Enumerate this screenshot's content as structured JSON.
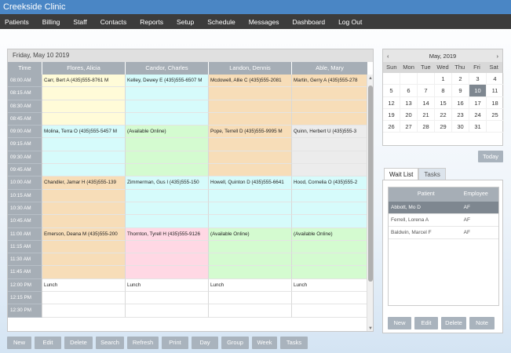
{
  "app": {
    "title": "Creekside Clinic"
  },
  "menu": [
    "Patients",
    "Billing",
    "Staff",
    "Contacts",
    "Reports",
    "Setup",
    "Schedule",
    "Messages",
    "Dashboard",
    "Log Out"
  ],
  "schedule": {
    "date": "Friday, May  10  2019",
    "time_header": "Time",
    "columns": [
      "Flores, Alicia",
      "Candor, Charles",
      "Landon, Dennis",
      "Able, Mary"
    ],
    "rows": [
      {
        "time": "08:00 AM",
        "cells": [
          [
            "Carr, Bert A (435)555-8761 M",
            "#fffbd8"
          ],
          [
            "Kelley, Dewey E (435)555-6507 M",
            "#d6fbfb"
          ],
          [
            "Mcdowell, Allie C (435)555-2081",
            "#f7ddb8"
          ],
          [
            "Martin, Gerry A (435)555-278",
            "#f7ddb8"
          ]
        ]
      },
      {
        "time": "08:15 AM",
        "cells": [
          [
            "",
            "#fffbd8"
          ],
          [
            "",
            "#d6fbfb"
          ],
          [
            "",
            "#f7ddb8"
          ],
          [
            "",
            "#f7ddb8"
          ]
        ]
      },
      {
        "time": "08:30 AM",
        "cells": [
          [
            "",
            "#fffbd8"
          ],
          [
            "",
            "#d6fbfb"
          ],
          [
            "",
            "#f7ddb8"
          ],
          [
            "",
            "#f7ddb8"
          ]
        ]
      },
      {
        "time": "08:45 AM",
        "cells": [
          [
            "",
            "#fffbd8"
          ],
          [
            "",
            "#d6fbfb"
          ],
          [
            "",
            "#f7ddb8"
          ],
          [
            "",
            "#f7ddb8"
          ]
        ]
      },
      {
        "time": "09:00 AM",
        "cells": [
          [
            "Molina, Terra O (435)555-5457 M",
            "#d6fbfb"
          ],
          [
            "(Available Online)",
            "#d4fbd0"
          ],
          [
            "Pope, Terrell D (435)555-9995 M",
            "#f7ddb8"
          ],
          [
            "Quinn, Herbert U (435)555-3",
            "#ececec"
          ]
        ]
      },
      {
        "time": "09:15 AM",
        "cells": [
          [
            "",
            "#d6fbfb"
          ],
          [
            "",
            "#d4fbd0"
          ],
          [
            "",
            "#f7ddb8"
          ],
          [
            "",
            "#ececec"
          ]
        ]
      },
      {
        "time": "09:30 AM",
        "cells": [
          [
            "",
            "#d6fbfb"
          ],
          [
            "",
            "#d4fbd0"
          ],
          [
            "",
            "#f7ddb8"
          ],
          [
            "",
            "#ececec"
          ]
        ]
      },
      {
        "time": "09:45 AM",
        "cells": [
          [
            "",
            "#d6fbfb"
          ],
          [
            "",
            "#d4fbd0"
          ],
          [
            "",
            "#f7ddb8"
          ],
          [
            "",
            "#ececec"
          ]
        ]
      },
      {
        "time": "10:00 AM",
        "cells": [
          [
            "Chandler, Jamar H (435)555-139",
            "#f7ddb8"
          ],
          [
            "Zimmerman, Gus I (435)555-150",
            "#d6fbfb"
          ],
          [
            "Howell, Quinton D (435)555-6641",
            "#d6fbfb"
          ],
          [
            "Hood, Cornelia O (435)555-2",
            "#d6fbfb"
          ]
        ]
      },
      {
        "time": "10:15 AM",
        "cells": [
          [
            "",
            "#f7ddb8"
          ],
          [
            "",
            "#d6fbfb"
          ],
          [
            "",
            "#d6fbfb"
          ],
          [
            "",
            "#d6fbfb"
          ]
        ]
      },
      {
        "time": "10:30 AM",
        "cells": [
          [
            "",
            "#f7ddb8"
          ],
          [
            "",
            "#d6fbfb"
          ],
          [
            "",
            "#d6fbfb"
          ],
          [
            "",
            "#d6fbfb"
          ]
        ]
      },
      {
        "time": "10:45 AM",
        "cells": [
          [
            "",
            "#f7ddb8"
          ],
          [
            "",
            "#d6fbfb"
          ],
          [
            "",
            "#d6fbfb"
          ],
          [
            "",
            "#d6fbfb"
          ]
        ]
      },
      {
        "time": "11:00 AM",
        "cells": [
          [
            "Emerson, Deana M (435)555-200",
            "#f7ddb8"
          ],
          [
            "Thornton, Tyrell H (435)555-9126",
            "#ffd8e4"
          ],
          [
            "(Available Online)",
            "#d4fbd0"
          ],
          [
            "(Available Online)",
            "#d4fbd0"
          ]
        ]
      },
      {
        "time": "11:15 AM",
        "cells": [
          [
            "",
            "#f7ddb8"
          ],
          [
            "",
            "#ffd8e4"
          ],
          [
            "",
            "#d4fbd0"
          ],
          [
            "",
            "#d4fbd0"
          ]
        ]
      },
      {
        "time": "11:30 AM",
        "cells": [
          [
            "",
            "#f7ddb8"
          ],
          [
            "",
            "#ffd8e4"
          ],
          [
            "",
            "#d4fbd0"
          ],
          [
            "",
            "#d4fbd0"
          ]
        ]
      },
      {
        "time": "11:45 AM",
        "cells": [
          [
            "",
            "#f7ddb8"
          ],
          [
            "",
            "#ffd8e4"
          ],
          [
            "",
            "#d4fbd0"
          ],
          [
            "",
            "#d4fbd0"
          ]
        ]
      },
      {
        "time": "12:00 PM",
        "cells": [
          [
            "Lunch",
            "#ffffff"
          ],
          [
            "Lunch",
            "#ffffff"
          ],
          [
            "Lunch",
            "#ffffff"
          ],
          [
            "Lunch",
            "#ffffff"
          ]
        ]
      },
      {
        "time": "12:15 PM",
        "cells": [
          [
            "",
            "#ffffff"
          ],
          [
            "",
            "#ffffff"
          ],
          [
            "",
            "#ffffff"
          ],
          [
            "",
            "#ffffff"
          ]
        ]
      },
      {
        "time": "12:30 PM",
        "cells": [
          [
            "",
            "#ffffff"
          ],
          [
            "",
            "#ffffff"
          ],
          [
            "",
            "#ffffff"
          ],
          [
            "",
            "#ffffff"
          ]
        ]
      }
    ],
    "buttons": [
      "New",
      "Edit",
      "Delete",
      "Search",
      "Refresh",
      "Print",
      "Day",
      "Group",
      "Week",
      "Tasks"
    ]
  },
  "calendar": {
    "month_label": "May, 2019",
    "prev": "‹",
    "next": "›",
    "days_of_week": [
      "Sun",
      "Mon",
      "Tue",
      "Wed",
      "Thu",
      "Fri",
      "Sat"
    ],
    "days": [
      "",
      "",
      "",
      "1",
      "2",
      "3",
      "4",
      "5",
      "6",
      "7",
      "8",
      "9",
      "10",
      "11",
      "12",
      "13",
      "14",
      "15",
      "16",
      "17",
      "18",
      "19",
      "20",
      "21",
      "22",
      "23",
      "24",
      "25",
      "26",
      "27",
      "28",
      "29",
      "30",
      "31",
      ""
    ],
    "selected": "10",
    "today_label": "Today"
  },
  "waitlist": {
    "tabs": [
      "Wait List",
      "Tasks"
    ],
    "headers": [
      "Patient",
      "Employee"
    ],
    "rows": [
      {
        "patient": "Abbott, Mo D",
        "employee": "AF"
      },
      {
        "patient": "Ferrell, Lorena A",
        "employee": "AF"
      },
      {
        "patient": "Baldwin, Marcel F",
        "employee": "AF"
      }
    ],
    "selected_index": 0,
    "buttons": [
      "New",
      "Edit",
      "Delete",
      "Note"
    ]
  }
}
